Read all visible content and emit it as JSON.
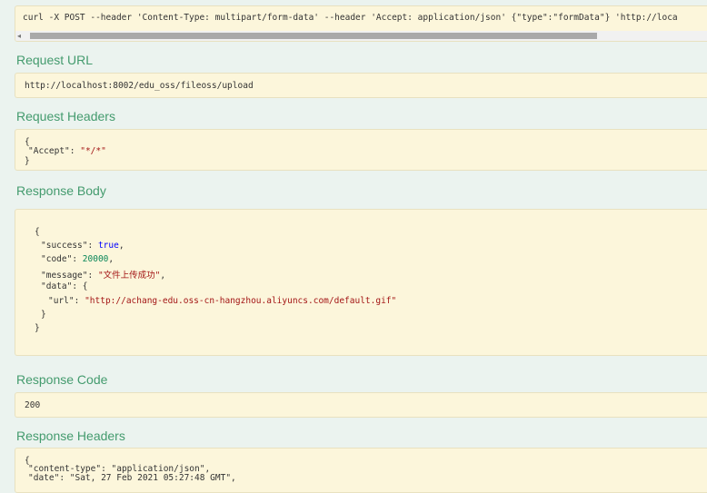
{
  "curl": {
    "command": "curl -X POST --header 'Content-Type: multipart/form-data' --header 'Accept: application/json' {\"type\":\"formData\"} 'http://loca"
  },
  "request_url": {
    "title": "Request URL",
    "value": "http://localhost:8002/edu_oss/fileoss/upload"
  },
  "request_headers": {
    "title": "Request Headers",
    "open_brace": "{",
    "line1_key": "\"Accept\"",
    "line1_sep": ": ",
    "line1_value": "\"*/*\"",
    "close_brace": "}"
  },
  "response_body": {
    "title": "Response Body",
    "open_brace": "{",
    "success_key": "\"success\"",
    "success_value": "true",
    "code_key": "\"code\"",
    "code_value": "20000",
    "message_key": "\"message\"",
    "message_value": "\"文件上传成功\"",
    "data_key": "\"data\"",
    "data_open": "{",
    "url_key": "\"url\"",
    "url_value": "\"http://achang-edu.oss-cn-hangzhou.aliyuncs.com/default.gif\"",
    "data_close": "}",
    "close_brace": "}"
  },
  "response_code": {
    "title": "Response Code",
    "value": "200"
  },
  "response_headers": {
    "title": "Response Headers",
    "open_brace": "{",
    "content_type_line": "\"content-type\": \"application/json\",",
    "date_line": "\"date\": \"Sat, 27 Feb 2021 05:27:48 GMT\","
  }
}
